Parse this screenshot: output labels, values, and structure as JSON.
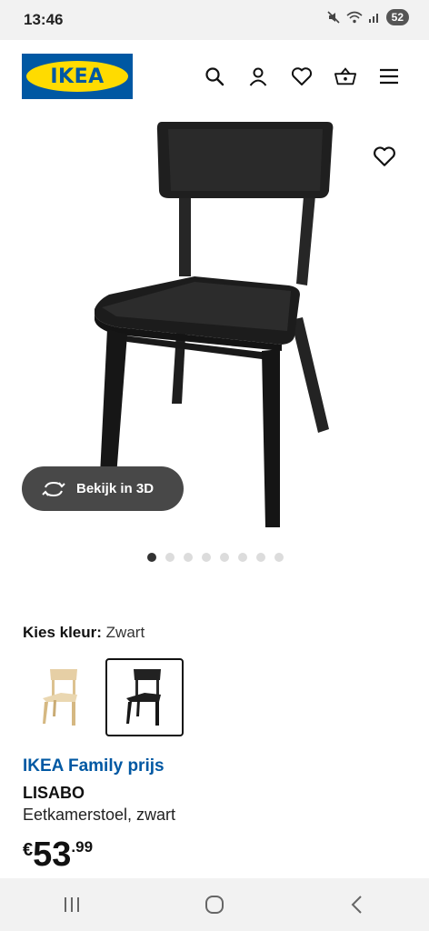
{
  "status_bar": {
    "time": "13:46",
    "battery": "52"
  },
  "header": {
    "logo_text": "IKEA",
    "icons": [
      "search-icon",
      "user-icon",
      "heart-icon",
      "basket-icon",
      "menu-icon"
    ]
  },
  "gallery": {
    "view_3d_label": "Bekijk in 3D",
    "dot_count": 8,
    "active_dot": 1
  },
  "color": {
    "label": "Kies kleur:",
    "value": "Zwart",
    "swatches": [
      "birch-chair",
      "black-chair"
    ],
    "selected_index": 1
  },
  "product": {
    "family_label": "IKEA Family prijs",
    "name": "LISABO",
    "description": "Eetkamerstoel, zwart",
    "price_currency": "€",
    "price_integer": "53",
    "price_decimal": ".99"
  },
  "colors": {
    "ikea_blue": "#0058a3",
    "ikea_yellow": "#ffdb00",
    "button_dark": "#484848"
  }
}
